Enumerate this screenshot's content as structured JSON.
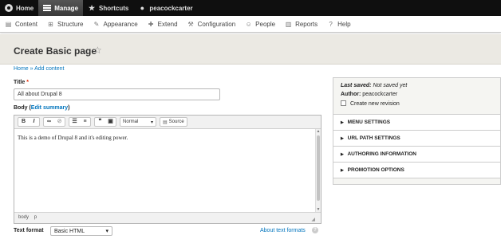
{
  "toolbar": {
    "home": "Home",
    "manage": "Manage",
    "shortcuts": "Shortcuts",
    "user": "peacockcarter"
  },
  "tray": {
    "items": [
      "Content",
      "Structure",
      "Appearance",
      "Extend",
      "Configuration",
      "People",
      "Reports",
      "Help"
    ]
  },
  "page": {
    "title": "Create Basic page"
  },
  "breadcrumb": {
    "home": "Home",
    "sep": "»",
    "add": "Add content"
  },
  "form": {
    "title_label": "Title",
    "required_mark": "*",
    "title_value": "All about Drupal 8",
    "body_label": "Body",
    "edit_summary_open": "(",
    "edit_summary": "Edit summary",
    "edit_summary_close": ")",
    "editor": {
      "bold": "B",
      "italic": "I",
      "format_select": "Normal",
      "source": "Source",
      "content": "This is a demo of Drupal 8 and it's editing power.",
      "path": [
        "body",
        "p"
      ]
    },
    "text_format_label": "Text format",
    "text_format_value": "Basic HTML",
    "about_formats": "About text formats"
  },
  "sidebar": {
    "last_saved_label": "Last saved:",
    "last_saved_value": "Not saved yet",
    "author_label": "Author:",
    "author_value": "peacockcarter",
    "new_revision": "Create new revision",
    "sections": [
      "MENU SETTINGS",
      "URL PATH SETTINGS",
      "AUTHORING INFORMATION",
      "PROMOTION OPTIONS"
    ]
  }
}
